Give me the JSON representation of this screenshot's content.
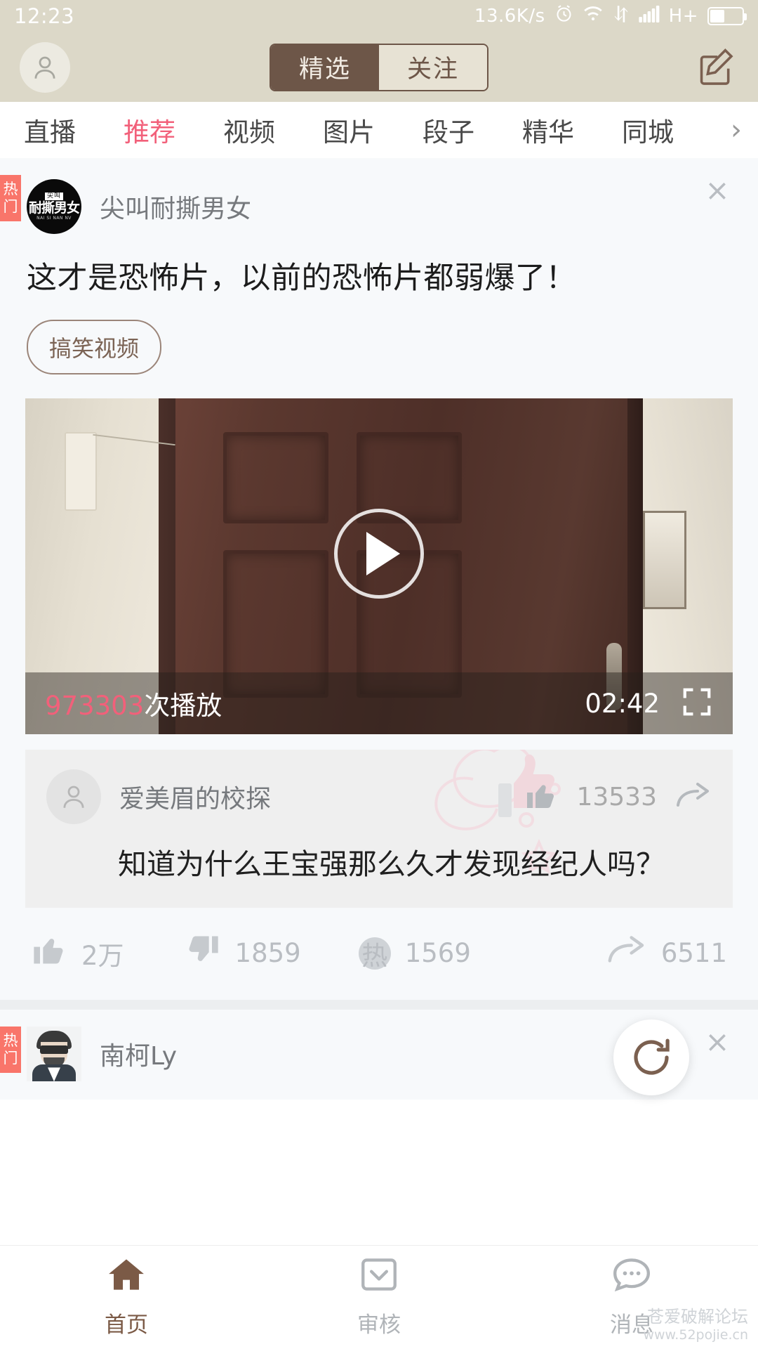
{
  "status_bar": {
    "time": "12:23",
    "network_speed": "13.6K/s",
    "network_type": "H+",
    "icons": [
      "alarm-icon",
      "wifi-icon",
      "data-transfer-icon",
      "signal-icon",
      "battery-icon"
    ]
  },
  "top_bar": {
    "avatar_icon": "user-avatar-icon",
    "compose_icon": "compose-edit-icon",
    "segments": [
      {
        "label": "精选",
        "active": true
      },
      {
        "label": "关注",
        "active": false
      }
    ]
  },
  "category_tabs": {
    "items": [
      {
        "label": "直播",
        "active": false
      },
      {
        "label": "推荐",
        "active": true
      },
      {
        "label": "视频",
        "active": false
      },
      {
        "label": "图片",
        "active": false
      },
      {
        "label": "段子",
        "active": false
      },
      {
        "label": "精华",
        "active": false
      },
      {
        "label": "同城",
        "active": false
      }
    ],
    "more_arrow": "›"
  },
  "post": {
    "hot_badge": "热门",
    "close_icon": "close-icon",
    "author": "尖叫耐撕男女",
    "avatar_logo_top": "尖叫",
    "avatar_logo_main": "耐撕男女",
    "avatar_logo_sub": "NAI SI NAN NV",
    "title": "这才是恐怖片，以前的恐怖片都弱爆了！",
    "tag": "搞笑视频",
    "video": {
      "play_icon": "play-button-icon",
      "play_count_number": "973303",
      "play_count_suffix": "次播放",
      "duration": "02:42",
      "fullscreen_icon": "fullscreen-icon"
    },
    "comment": {
      "avatar_icon": "user-avatar-icon",
      "author": "爱美眉的校探",
      "like_icon": "thumbs-up-icon",
      "like_count": "13533",
      "share_icon": "share-icon",
      "text": "知道为什么王宝强那么久才发现经纪人吗？"
    },
    "actions": {
      "like_icon": "thumbs-up-icon",
      "like_count": "2万",
      "dislike_icon": "thumbs-down-icon",
      "dislike_count": "1859",
      "comment_icon": "hot-comment-icon",
      "comment_badge": "热",
      "comment_count": "1569",
      "share_icon": "share-icon",
      "share_count": "6511"
    }
  },
  "post2": {
    "hot_badge": "热门",
    "close_icon": "close-icon",
    "author": "南柯Ly",
    "avatar_icon": "user-photo-avatar",
    "refresh_icon": "refresh-icon"
  },
  "bottom_nav": {
    "items": [
      {
        "label": "首页",
        "icon": "home-icon",
        "active": true
      },
      {
        "label": "审核",
        "icon": "review-icon",
        "active": false
      },
      {
        "label": "消息",
        "icon": "message-icon",
        "active": false
      }
    ]
  },
  "watermark": {
    "line1": "苍爱破解论坛",
    "line2": "www.52pojie.cn"
  },
  "colors": {
    "topbar_bg": "#dcd8c8",
    "accent_pink": "#f2607a",
    "brown": "#6d5648",
    "hot_red": "#f9756a",
    "feed_bg": "#f7f9fb"
  }
}
